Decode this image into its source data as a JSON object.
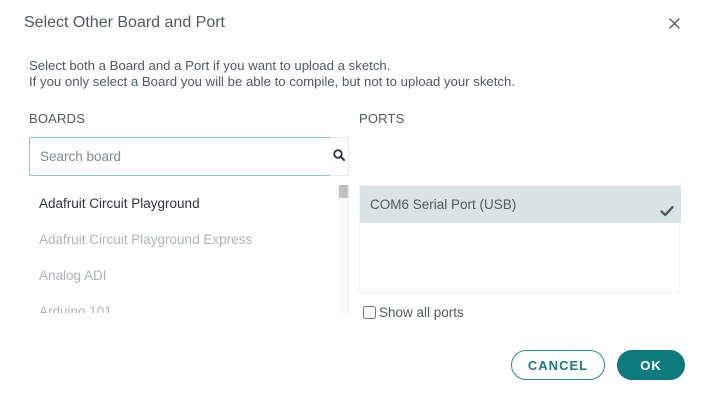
{
  "dialog": {
    "title": "Select Other Board and Port",
    "description_line1": "Select both a Board and a Port if you want to upload a sketch.",
    "description_line2": "If you only select a Board you will be able to compile, but not to upload your sketch."
  },
  "boards": {
    "label": "BOARDS",
    "search": {
      "placeholder": "Search board",
      "value": ""
    },
    "items": [
      {
        "label": "Adafruit Circuit Playground",
        "selected": true
      },
      {
        "label": "Adafruit Circuit Playground Express",
        "selected": false
      },
      {
        "label": "Analog ADI",
        "selected": false
      },
      {
        "label": "Arduino 101",
        "selected": false
      }
    ]
  },
  "ports": {
    "label": "PORTS",
    "items": [
      {
        "label": "COM6 Serial Port (USB)",
        "selected": true
      }
    ],
    "show_all_label": "Show all ports",
    "show_all_checked": false
  },
  "buttons": {
    "cancel": "CANCEL",
    "ok": "OK"
  },
  "icons": {
    "close": "close-icon",
    "search": "search-icon",
    "check": "checkmark-icon"
  },
  "colors": {
    "accent": "#0d7a7d",
    "selected_row": "#dae3e3",
    "text": "#4e5b61"
  }
}
